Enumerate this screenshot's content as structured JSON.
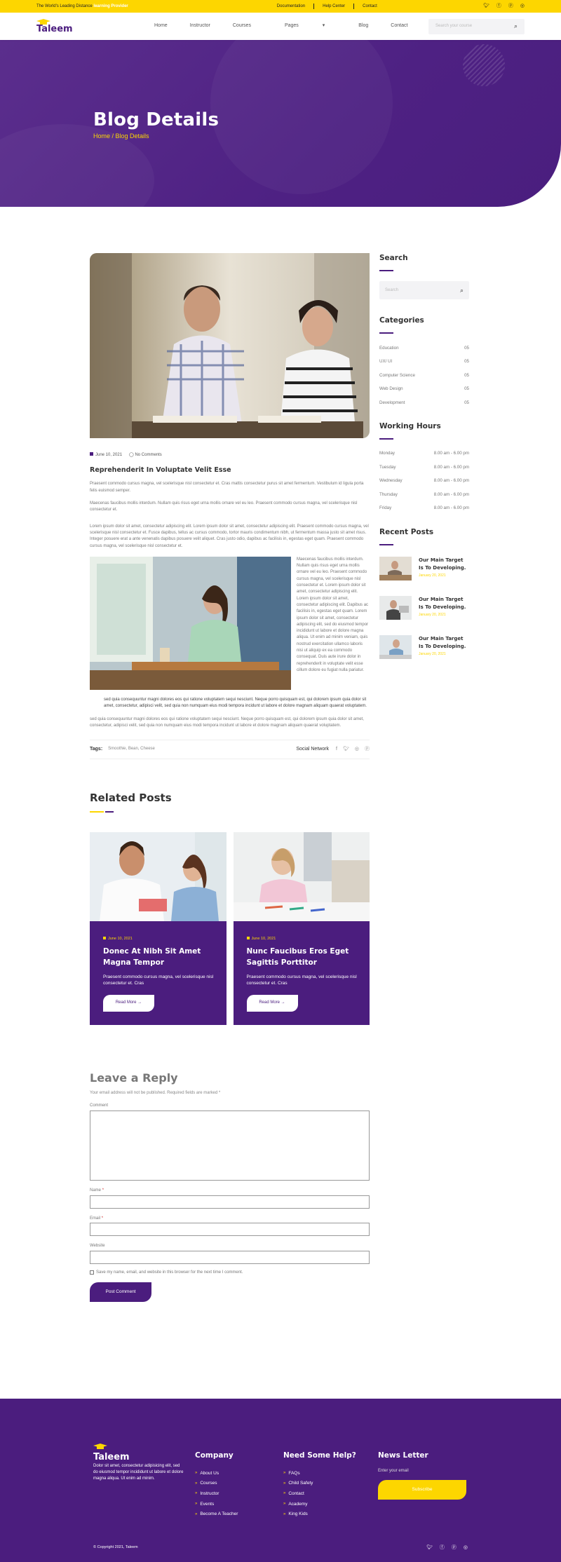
{
  "topbar": {
    "tagline_prefix": "The World's Leading Distance",
    "tagline_highlight": "learning Provider",
    "links": [
      "Documentation",
      "Help Center",
      "Contact"
    ],
    "socials": [
      "twitter-icon",
      "facebook-icon",
      "pinterest-icon",
      "instagram-icon"
    ]
  },
  "header": {
    "logo": "Taleem",
    "nav": [
      "Home",
      "Instructor",
      "Courses",
      "Pages",
      "Blog",
      "Contact"
    ],
    "search_placeholder": "Search your course"
  },
  "hero": {
    "title": "Blog Details",
    "breadcrumb": "Home / Blog Details"
  },
  "post": {
    "date": "June 10, 2021",
    "comments": "No Comments",
    "title": "Reprehenderit In Voluptate Velit Esse",
    "p1": "Praesent commodo cursus magna, vel scelerisque nisl consectetur et. Cras mattis consectetur purus sit amet fermentum. Vestibulum id ligula porta felis euismod semper.",
    "p2": "Maecenas faucibus mollis interdum. Nullam quis risus eget urna mollis ornare vel eu leo. Praesent commodo cursus magna, vel scelerisque nisl consectetur et.",
    "p3": "Lorem ipsum dolor sit amet, consectetur adipiscing elit. Lorem ipsum dolor sit amet, consectetur adipiscing elit. Praesent commodo cursus magna, vel scelerisque nisl consectetur et. Fusce dapibus, tellus ac cursus commodo, tortor mauris condimentum nibh, ut fermentum massa justo sit amet risus. Integer posuere erat a ante venenatis dapibus posuere velit aliquet. Cras justo odio, dapibus ac facilisis in, egestas eget quam. Praesent commodo cursus magna, vel scelerisque nisl consectetur et.",
    "float_text": "Maecenas faucibus mollis interdum. Nullam quis risus eget urna mollis ornare vel eu leo. Praesent commodo cursus magna, vel scelerisque nisl consectetur et. Lorem ipsum dolor sit amet, consectetur adipiscing elit. Lorem ipsum dolor sit amet, consectetur adipiscing elit. Dapibus ac facilisis in, egestas eget quam. Lorem ipsum dolor sit amet, consectetur adipiscing elit, sed do eiusmod tempor incididunt ut labore et dolore magna aliqua. Ut enim ad minim veniam, quis nostrud exercitation ullamco laboris nisi ut aliquip ex ea commodo consequat. Duis aute irure dolor in reprehenderit in voluptate velit esse cillum dolore eu fugiat nulla pariatur.",
    "quote": "sed quia consequuntur magni dolores eos qui ratione voluptatem sequi nesciunt. Neque porro quisquam est, qui dolorem ipsum quia dolor sit amet, consectetur, adipisci velit, sed quia non numquam eius modi tempora incidunt ut labore et dolore magnam aliquam quaerat voluptatem.",
    "p4": "sed quia consequuntur magni dolores eos qui ratione voluptatem sequi nesciunt. Neque porro quisquam est, qui dolorem ipsum quia dolor sit amet, consectetur, adipisci velit, sed quia non numquam eius modi tempora incidunt ut labore et dolore magnam aliquam quaerat voluptatem.",
    "tags_label": "Tags:",
    "tags": "Smoothie, Bean, Cheese",
    "social_label": "Social Network"
  },
  "related": {
    "title": "Related Posts",
    "cards": [
      {
        "date": "June 10, 2021",
        "title": "Donec At Nibh Sit Amet Magna Tempor",
        "excerpt": "Praesent commodo cursus magna, vel scelerisque nisl consectetur et. Cras",
        "button": "Read More →"
      },
      {
        "date": "June 10, 2021",
        "title": "Nunc Faucibus Eros Eget Sagittis Porttitor",
        "excerpt": "Praesent commodo cursus magna, vel scelerisque nisl consectetur et. Cras",
        "button": "Read More →"
      }
    ]
  },
  "reply": {
    "title": "Leave a Reply",
    "note": "Your email address will not be published. Required fields are marked *",
    "comment_label": "Comment",
    "name_label": "Name",
    "email_label": "Email",
    "website_label": "Website",
    "required_mark": "*",
    "save_label": "Save my name, email, and website in this browser for the next time I comment.",
    "button": "Post Comment"
  },
  "sidebar": {
    "search_title": "Search",
    "search_placeholder": "Search",
    "categories_title": "Categories",
    "categories": [
      {
        "name": "Education",
        "count": "05"
      },
      {
        "name": "UX/ UI",
        "count": "05"
      },
      {
        "name": "Computer Science",
        "count": "05"
      },
      {
        "name": "Web Design",
        "count": "05"
      },
      {
        "name": "Development",
        "count": "05"
      }
    ],
    "hours_title": "Working Hours",
    "hours": [
      {
        "day": "Monday",
        "time": "8.00 am - 6.00 pm"
      },
      {
        "day": "Tuesday",
        "time": "8.00 am - 6.00 pm"
      },
      {
        "day": "Wednesday",
        "time": "8.00 am - 6.00 pm"
      },
      {
        "day": "Thursday",
        "time": "8.00 am - 6.00 pm"
      },
      {
        "day": "Friday",
        "time": "8.00 am - 6.00 pm"
      }
    ],
    "recent_title": "Recent Posts",
    "recent": [
      {
        "title": "Our Main Target Is To Developing.",
        "date": "January 20, 2021"
      },
      {
        "title": "Our Main Target Is To Developing.",
        "date": "January 20, 2021"
      },
      {
        "title": "Our Main Target Is To Developing.",
        "date": "January 20, 2021"
      }
    ]
  },
  "footer": {
    "logo": "Taleem",
    "about": "Dolor sit amet, consectetur adipisicing elit, sed do eiusmod tempor incididunt ut labore et dolore magna aliqua. Ut enim ad minim.",
    "company_title": "Company",
    "company": [
      "About Us",
      "Courses",
      "Instructor",
      "Events",
      "Become A Teacher"
    ],
    "help_title": "Need Some Help?",
    "help": [
      "FAQs",
      "Child Safety",
      "Contact",
      "Academy",
      "King Kids"
    ],
    "newsletter_title": "News Letter",
    "email_placeholder": "Enter your email",
    "subscribe": "Subscribe",
    "copyright": "© Copyright 2021, Taleem"
  },
  "colors": {
    "brand_purple": "#4b1d7e",
    "accent_yellow": "#fdd600"
  }
}
